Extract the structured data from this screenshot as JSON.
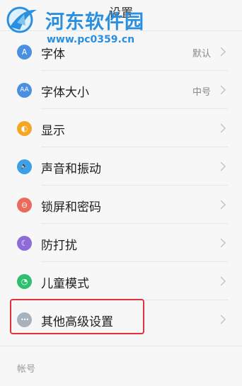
{
  "header": {
    "title": "设置",
    "watermark_title": "河东软件园",
    "watermark_url": "www.pc0359.cn"
  },
  "items": [
    {
      "label": "字体",
      "value": "默认",
      "icon": "font-icon",
      "icon_glyph": "A",
      "icon_color": "#4a90e2"
    },
    {
      "label": "字体大小",
      "value": "中号",
      "icon": "font-size-icon",
      "icon_glyph": "AA",
      "icon_color": "#4a90e2"
    },
    {
      "label": "显示",
      "value": "",
      "icon": "brightness-icon",
      "icon_glyph": "◐",
      "icon_color": "#f5a623"
    },
    {
      "label": "声音和振动",
      "value": "",
      "icon": "speaker-icon",
      "icon_glyph": "🔈",
      "icon_color": "#3aa0e8"
    },
    {
      "label": "锁屏和密码",
      "value": "",
      "icon": "lock-icon",
      "icon_glyph": "⊖",
      "icon_color": "#ec6a5b"
    },
    {
      "label": "防打扰",
      "value": "",
      "icon": "moon-icon",
      "icon_glyph": "☾",
      "icon_color": "#8e6bd8"
    },
    {
      "label": "儿童模式",
      "value": "",
      "icon": "child-mode-icon",
      "icon_glyph": "◔",
      "icon_color": "#2fbf71"
    },
    {
      "label": "其他高级设置",
      "value": "",
      "icon": "more-icon",
      "icon_glyph": "•••",
      "icon_color": "#a7b2bd"
    }
  ],
  "section_header": "帐号",
  "colors": {
    "highlight_border": "#e0323c",
    "watermark": "#2b8fe0"
  }
}
